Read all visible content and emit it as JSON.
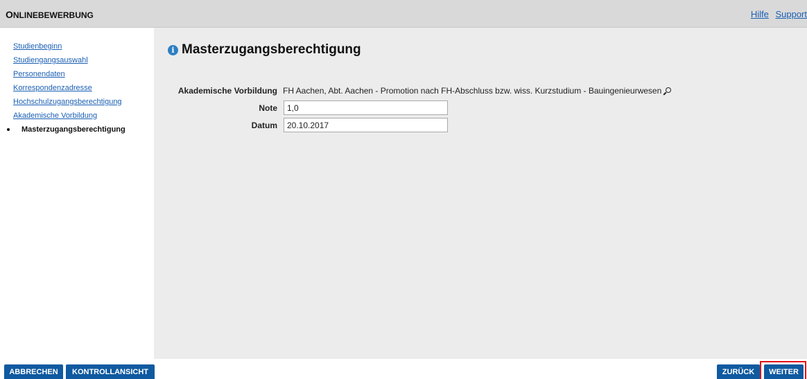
{
  "header": {
    "title_first": "O",
    "title_rest": "NLINEBEWERBUNG",
    "links": [
      "Hilfe",
      "Support"
    ]
  },
  "sidebar": {
    "items": [
      {
        "label": "Studienbeginn",
        "active": false
      },
      {
        "label": "Studiengangsauswahl",
        "active": false
      },
      {
        "label": "Personendaten",
        "active": false
      },
      {
        "label": "Korrespondenzadresse",
        "active": false
      },
      {
        "label": "Hochschulzugangsberechtigung",
        "active": false
      },
      {
        "label": "Akademische Vorbildung",
        "active": false
      },
      {
        "label": "Masterzugangsberechtigung",
        "active": true
      }
    ]
  },
  "main": {
    "title": "Masterzugangsberechtigung",
    "info_icon_glyph": "i",
    "fields": {
      "vorbildung": {
        "label": "Akademische Vorbildung",
        "value": "FH Aachen, Abt. Aachen - Promotion nach FH-Abschluss bzw. wiss. Kurzstudium - Bauingenieurwesen"
      },
      "note": {
        "label": "Note",
        "value": "1,0"
      },
      "datum": {
        "label": "Datum",
        "value": "20.10.2017"
      }
    }
  },
  "footer": {
    "abbrechen": "ABBRECHEN",
    "kontrollansicht": "KONTROLLANSICHT",
    "zurueck": "ZURÜCK",
    "weiter": "WEITER"
  },
  "colors": {
    "header_bg": "#d9d9d9",
    "content_bg": "#ececec",
    "link": "#1a5fb4",
    "button_bg": "#0f5aa0",
    "highlight_border": "#e3121a",
    "info_icon": "#2d7fc2"
  }
}
